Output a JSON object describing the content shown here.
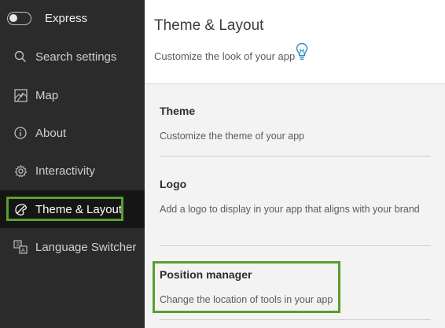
{
  "sidebar": {
    "express_label": "Express",
    "toggle_on": false,
    "items": [
      {
        "label": "Search settings",
        "icon": "search-icon"
      },
      {
        "label": "Map",
        "icon": "map-icon"
      },
      {
        "label": "About",
        "icon": "info-icon"
      },
      {
        "label": "Interactivity",
        "icon": "gear-icon"
      },
      {
        "label": "Theme & Layout",
        "icon": "palette-icon",
        "active": true
      },
      {
        "label": "Language Switcher",
        "icon": "language-icon"
      }
    ]
  },
  "main": {
    "title": "Theme & Layout",
    "subtitle": "Customize the look of your app",
    "tip_icon": "lightbulb-icon",
    "sections": [
      {
        "title": "Theme",
        "description": "Customize the theme of your app"
      },
      {
        "title": "Logo",
        "description": "Add a logo to display in your app that aligns with your brand"
      },
      {
        "title": "Position manager",
        "description": "Change the location of tools in your app"
      }
    ]
  },
  "colors": {
    "sidebar_bg": "#2b2b2b",
    "active_bg": "#151515",
    "highlight": "#5a9f2c",
    "accent": "#2e8bc0"
  }
}
